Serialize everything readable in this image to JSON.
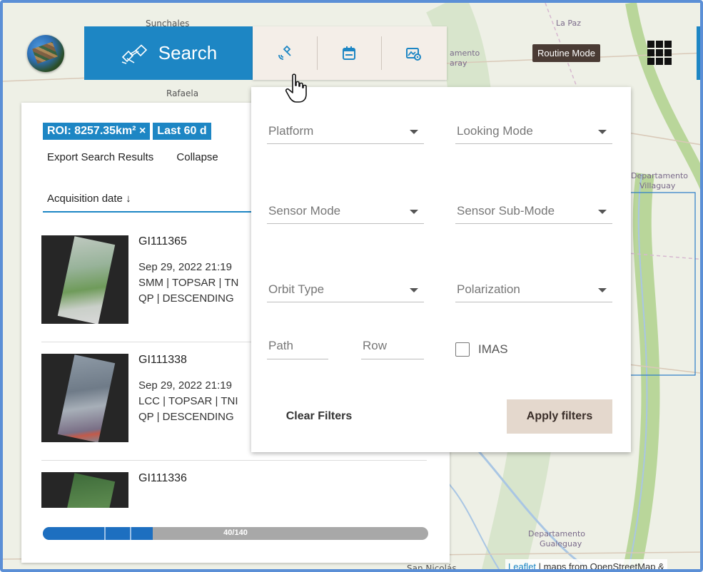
{
  "map": {
    "labels": [
      "Sunchales",
      "Rafaela",
      "La Paz",
      "Departamento",
      "Villaguay",
      "Departamento",
      "Gualeguay",
      "San Nicolás",
      "amento",
      "aray"
    ],
    "colors": {
      "land": "#eef0e6",
      "river": "#a9c6e4",
      "green": "#b9d69a",
      "road": "#d9c9b8"
    }
  },
  "header": {
    "search_label": "Search",
    "routine_mode_label": "Routine Mode",
    "tools": [
      {
        "icon": "satellite-icon"
      },
      {
        "icon": "calendar-icon"
      },
      {
        "icon": "image-settings-icon"
      }
    ],
    "accent": "#1d86c4"
  },
  "panel": {
    "chip_roi": "ROI: 8257.35km² ×",
    "chip_date": "Last 60 d",
    "export_label": "Export Search Results",
    "collapse_label": "Collapse",
    "sort_label": "Acquisition date ↓",
    "results": [
      {
        "id": "GI111365",
        "date": "Sep 29, 2022 21:19",
        "line2": "SMM | TOPSAR | TN",
        "line3": "QP | DESCENDING"
      },
      {
        "id": "GI111338",
        "date": "Sep 29, 2022 21:19",
        "line2": "LCC | TOPSAR | TNI",
        "line3": "QP | DESCENDING"
      },
      {
        "id": "GI111336",
        "date": "",
        "line2": "",
        "line3": ""
      }
    ],
    "progress": {
      "text": "40/140",
      "fraction": 0.2857
    }
  },
  "filters": {
    "platform": "Platform",
    "looking_mode": "Looking Mode",
    "sensor_mode": "Sensor Mode",
    "sensor_sub_mode": "Sensor Sub-Mode",
    "orbit_type": "Orbit Type",
    "polarization": "Polarization",
    "path": "Path",
    "row": "Row",
    "imas": "IMAS",
    "clear": "Clear Filters",
    "apply": "Apply filters"
  },
  "attribution": {
    "leaflet": "Leaflet",
    "rest": " | maps from OpenStreetMap &"
  }
}
